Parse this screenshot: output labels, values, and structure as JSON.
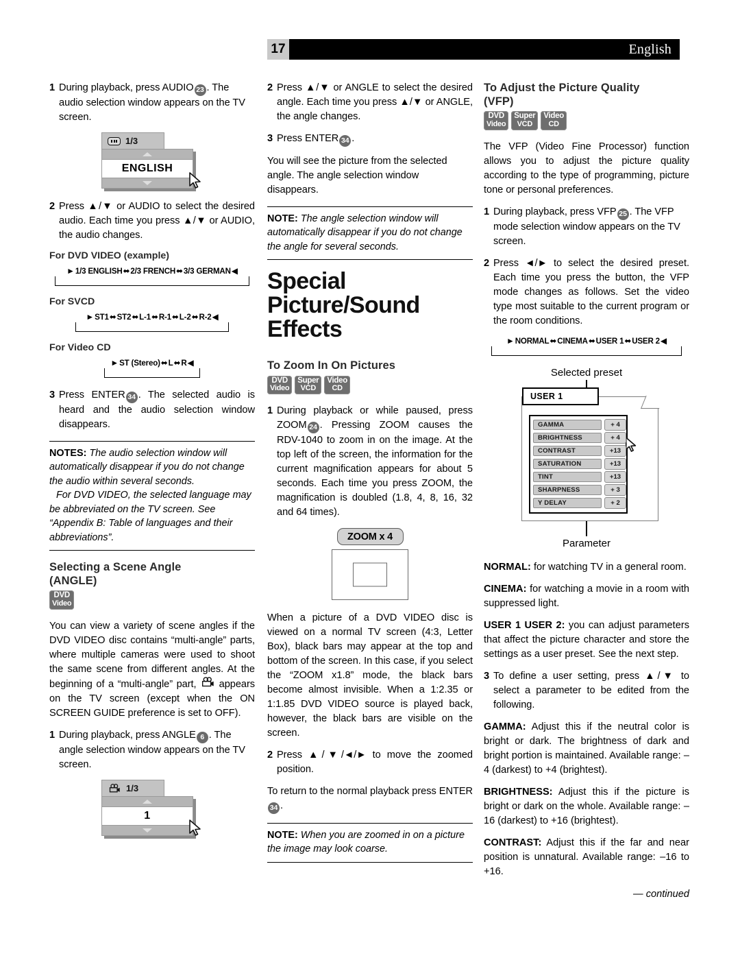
{
  "header": {
    "page_number": "17",
    "language": "English"
  },
  "left_column": {
    "step1": {
      "num": "1",
      "text_a": "During playback, press AUDIO",
      "keynum": "23",
      "text_b": ". The audio selection window appears on the TV screen."
    },
    "audio_osd": {
      "icon": "audio-icon",
      "counter": "1/3",
      "value": "ENGLISH"
    },
    "step2": {
      "num": "2",
      "text": "Press ▲/▼ or AUDIO to select the desired audio. Each time you press ▲/▼ or AUDIO, the audio changes."
    },
    "cycles": [
      {
        "label": "For DVD VIDEO (example)",
        "items": [
          "1/3 ENGLISH",
          "2/3 FRENCH",
          "3/3 GERMAN"
        ]
      },
      {
        "label": "For SVCD",
        "items": [
          "ST1",
          "ST2",
          "L-1",
          "R-1",
          "L-2",
          "R-2"
        ]
      },
      {
        "label": "For Video CD",
        "items": [
          "ST (Stereo)",
          "L",
          "R"
        ]
      }
    ],
    "step3": {
      "num": "3",
      "text_a": "Press ENTER",
      "keynum": "34",
      "text_b": ". The selected audio is heard and the audio selection window disappears."
    },
    "notes": {
      "label": "NOTES:",
      "line1": " The audio selection window will automatically disappear if you do not change the audio within several seconds.",
      "line2": "For DVD VIDEO, the selected language may be abbreviated on the TV screen. See “Appendix B: Table of languages and their abbreviations”."
    },
    "angle_heading_line1": "Selecting a Scene Angle",
    "angle_heading_line2": "(ANGLE)",
    "angle_badges": [
      {
        "l1": "DVD",
        "l2": "Video"
      }
    ],
    "angle_intro_a": "You can view a variety of scene angles if the DVD VIDEO disc contains “multi-angle” parts, where multiple cameras were used to shoot the same scene from different angles. At the beginning of a “multi-angle” part,",
    "angle_intro_b": "appears on the TV screen (except when the ON SCREEN GUIDE preference is set to OFF).",
    "angle_step1": {
      "num": "1",
      "text_a": "During playback, press ANGLE",
      "keynum": "6",
      "text_b": ". The angle selection window appears on the TV screen."
    },
    "angle_osd": {
      "icon": "camera-icon",
      "counter": "1/3",
      "value": "1"
    }
  },
  "mid_column": {
    "step2": {
      "num": "2",
      "text": "Press ▲/▼ or ANGLE to select the desired angle. Each time you press ▲/▼ or ANGLE, the angle changes."
    },
    "step3": {
      "num": "3",
      "text_a": "Press ENTER",
      "keynum": "34",
      "text_b": "."
    },
    "para_after": "You will see the picture from the selected angle. The angle selection window disappears.",
    "note": {
      "label": "NOTE:",
      "text": " The angle selection window will automatically disappear if you do not change the angle for several seconds."
    },
    "big_title_line1": "Special Picture/Sound",
    "big_title_line2": "Effects",
    "zoom_heading": "To Zoom In On Pictures",
    "zoom_badges": [
      {
        "l1": "DVD",
        "l2": "Video"
      },
      {
        "l1": "Super",
        "l2": "VCD"
      },
      {
        "l1": "Video",
        "l2": "CD"
      }
    ],
    "zoom_step1": {
      "num": "1",
      "text_a": "During playback or while paused, press ZOOM",
      "keynum": "24",
      "text_b": ". Pressing ZOOM causes the RDV-1040 to zoom in on the image. At the top left of the screen, the information for the current magnification appears for about 5 seconds. Each time you press ZOOM, the magnification is doubled (1.8, 4, 8, 16, 32 and 64 times)."
    },
    "zoom_graphic": {
      "pill_label": "ZOOM x 4"
    },
    "zoom_para": "When a picture of a DVD VIDEO disc is viewed on a normal TV screen (4:3, Letter Box), black bars may appear at the top and bottom of the screen. In this case, if you select the “ZOOM x1.8” mode, the black bars become almost invisible. When a 1:2.35 or 1:1.85 DVD VIDEO source is played back, however, the black bars are visible on the screen.",
    "zoom_step2": {
      "num": "2",
      "text": "Press ▲/▼/◄/► to move the zoomed position."
    },
    "zoom_return_a": "To return to the normal playback press ENTER",
    "zoom_return_keynum": "34",
    "zoom_return_b": ".",
    "zoom_note": {
      "label": "NOTE:",
      "text": " When you are zoomed in on a picture the image may look coarse."
    }
  },
  "right_column": {
    "vfp_heading_line1": "To Adjust the Picture Quality",
    "vfp_heading_line2": "(VFP)",
    "vfp_badges": [
      {
        "l1": "DVD",
        "l2": "Video"
      },
      {
        "l1": "Super",
        "l2": "VCD"
      },
      {
        "l1": "Video",
        "l2": "CD"
      }
    ],
    "vfp_intro": "The VFP (Video Fine Processor) function allows you to adjust the picture quality according to the type of programming, picture tone or personal preferences.",
    "step1": {
      "num": "1",
      "text_a": "During playback, press VFP",
      "keynum": "25",
      "text_b": ". The VFP mode selection window appears on the TV screen."
    },
    "step2": {
      "num": "2",
      "text": "Press ◄/► to select the desired preset. Each time you press the button, the VFP mode changes as follows. Set the video type most suitable to the current program or the room conditions."
    },
    "preset_cycle": [
      "NORMAL",
      "CINEMA",
      "USER 1",
      "USER 2"
    ],
    "vfp_panel": {
      "top_caption": "Selected preset",
      "bottom_caption": "Parameter",
      "preset_name": "USER 1",
      "parameters": [
        {
          "name": "GAMMA",
          "value": "+ 4"
        },
        {
          "name": "BRIGHTNESS",
          "value": "+ 4"
        },
        {
          "name": "CONTRAST",
          "value": "+13"
        },
        {
          "name": "SATURATION",
          "value": "+13"
        },
        {
          "name": "TINT",
          "value": "+13"
        },
        {
          "name": "SHARPNESS",
          "value": "+ 3"
        },
        {
          "name": "Y DELAY",
          "value": "+ 2"
        }
      ]
    },
    "defs": [
      {
        "term": "NORMAL:",
        "text": " for watching TV in a general room."
      },
      {
        "term": "CINEMA:",
        "text": " for watching a movie in a room with suppressed light."
      },
      {
        "term": "USER 1 USER 2:",
        "text": " you can adjust parameters that affect the picture character and store the settings as a user preset. See the next step."
      }
    ],
    "step3": {
      "num": "3",
      "text": "To define a user setting, press ▲/▼ to select a parameter to be edited from the following."
    },
    "param_defs": [
      {
        "term": "GAMMA:",
        "text": " Adjust this if the neutral color is bright or dark. The brightness of dark and bright portion is maintained. Available range: –4 (darkest) to +4 (brightest)."
      },
      {
        "term": "BRIGHTNESS:",
        "text": " Adjust this if the picture is bright or dark on the whole. Available range: –16 (darkest) to +16 (brightest)."
      },
      {
        "term": "CONTRAST:",
        "text": " Adjust this if the far and near position is unnatural. Available range: –16 to +16."
      }
    ],
    "continued": "— continued"
  }
}
